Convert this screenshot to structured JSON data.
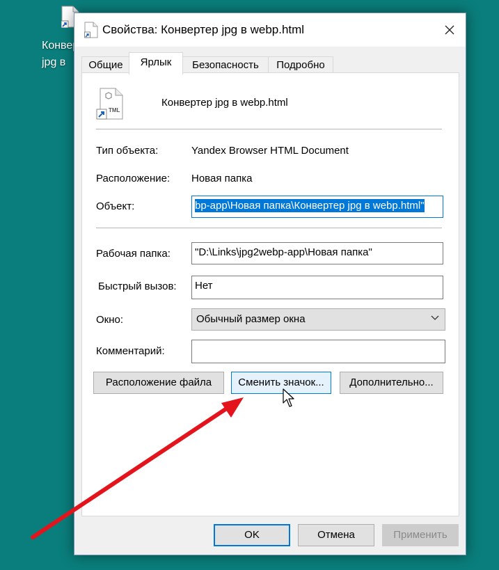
{
  "desktop": {
    "icon_label_line1": "Конвер",
    "icon_label_line2": "jpg в"
  },
  "dialog": {
    "title": "Свойства: Конвертер jpg в webp.html",
    "tabs": [
      {
        "label": "Общие"
      },
      {
        "label": "Ярлык",
        "active": true
      },
      {
        "label": "Безопасность"
      },
      {
        "label": "Подробно"
      }
    ],
    "file_name": "Конвертер jpg в webp.html",
    "file_icon_text": "TML",
    "fields": {
      "object_type_label": "Тип объекта:",
      "object_type_value": "Yandex Browser HTML Document",
      "location_label": "Расположение:",
      "location_value": "Новая папка",
      "target_label": "Объект:",
      "target_value": "bp-app\\Новая папка\\Конвертер jpg в webp.html\"",
      "workdir_label": "Рабочая папка:",
      "workdir_value": "\"D:\\Links\\jpg2webp-app\\Новая папка\"",
      "hotkey_label": "Быстрый вызов:",
      "hotkey_value": "Нет",
      "window_label": "Окно:",
      "window_value": "Обычный размер окна",
      "comment_label": "Комментарий:",
      "comment_value": ""
    },
    "buttons": {
      "open_location": "Расположение файла",
      "change_icon": "Сменить значок...",
      "advanced": "Дополнительно...",
      "ok": "OK",
      "cancel": "Отмена",
      "apply": "Применить"
    }
  },
  "colors": {
    "desktop_bg": "#0a7e7c",
    "selection": "#0078d7",
    "annotation_arrow": "#e3141b"
  }
}
